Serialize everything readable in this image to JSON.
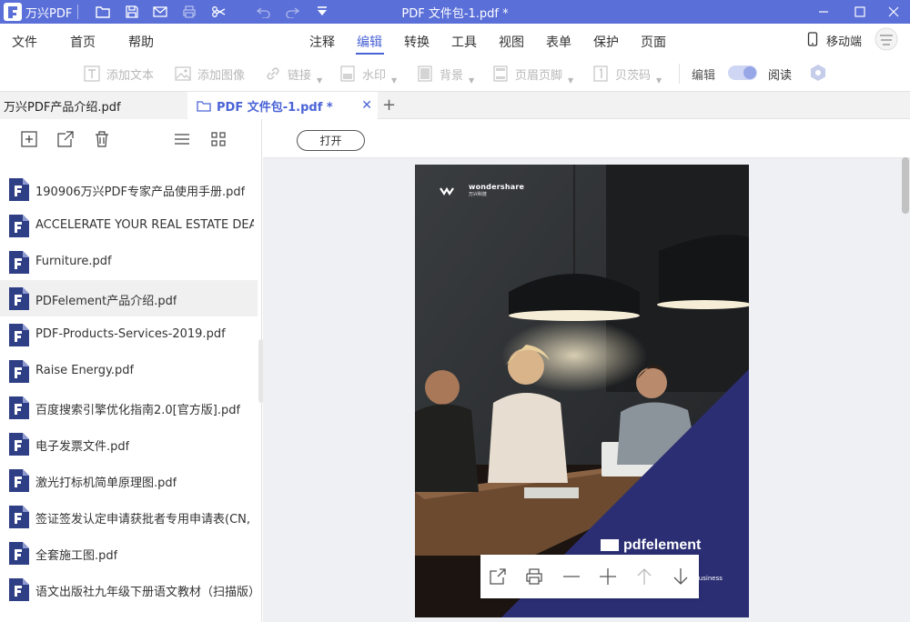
{
  "titlebar": {
    "app_name": "万兴PDF",
    "doc_title": "PDF 文件包-1.pdf *"
  },
  "menu": {
    "left": [
      "文件",
      "首页",
      "帮助"
    ],
    "center": [
      "注释",
      "编辑",
      "转换",
      "工具",
      "视图",
      "表单",
      "保护",
      "页面"
    ],
    "active": "编辑",
    "mobile": "移动端"
  },
  "toolbar": {
    "add_text": "添加文本",
    "add_image": "添加图像",
    "link": "链接",
    "watermark": "水印",
    "background": "背景",
    "header_footer": "页眉页脚",
    "bates": "贝茨码",
    "edit": "编辑",
    "read": "阅读"
  },
  "tabs": [
    {
      "label": "万兴PDF产品介绍.pdf"
    },
    {
      "label": "PDF 文件包-1.pdf *"
    }
  ],
  "sidebar": {
    "files": [
      {
        "name": "190906万兴PDF专家产品使用手册.pdf"
      },
      {
        "name": "ACCELERATE YOUR REAL ESTATE DEAL..."
      },
      {
        "name": "Furniture.pdf"
      },
      {
        "name": "PDFelement产品介绍.pdf"
      },
      {
        "name": "PDF-Products-Services-2019.pdf"
      },
      {
        "name": "Raise Energy.pdf"
      },
      {
        "name": "百度搜索引擎优化指南2.0[官方版].pdf"
      },
      {
        "name": "电子发票文件.pdf"
      },
      {
        "name": "激光打标机简单原理图.pdf"
      },
      {
        "name": "签证签发认定申请获批者专用申请表(CN, E..."
      },
      {
        "name": "全套施工图.pdf"
      },
      {
        "name": "语文出版社九年级下册语文教材（扫描版）..."
      }
    ],
    "selected": "PDFelement产品介绍.pdf"
  },
  "viewer": {
    "open_label": "打开",
    "cover": {
      "brand": "wondershare",
      "brand_sub": "万兴科技",
      "logo": "pdfelement",
      "tagline": "Business"
    }
  },
  "colors": {
    "accent": "#4a63d6",
    "titlebar": "#5a6fd8",
    "file_icon": "#2f3f85",
    "cover_triangle": "#2b2e73"
  }
}
